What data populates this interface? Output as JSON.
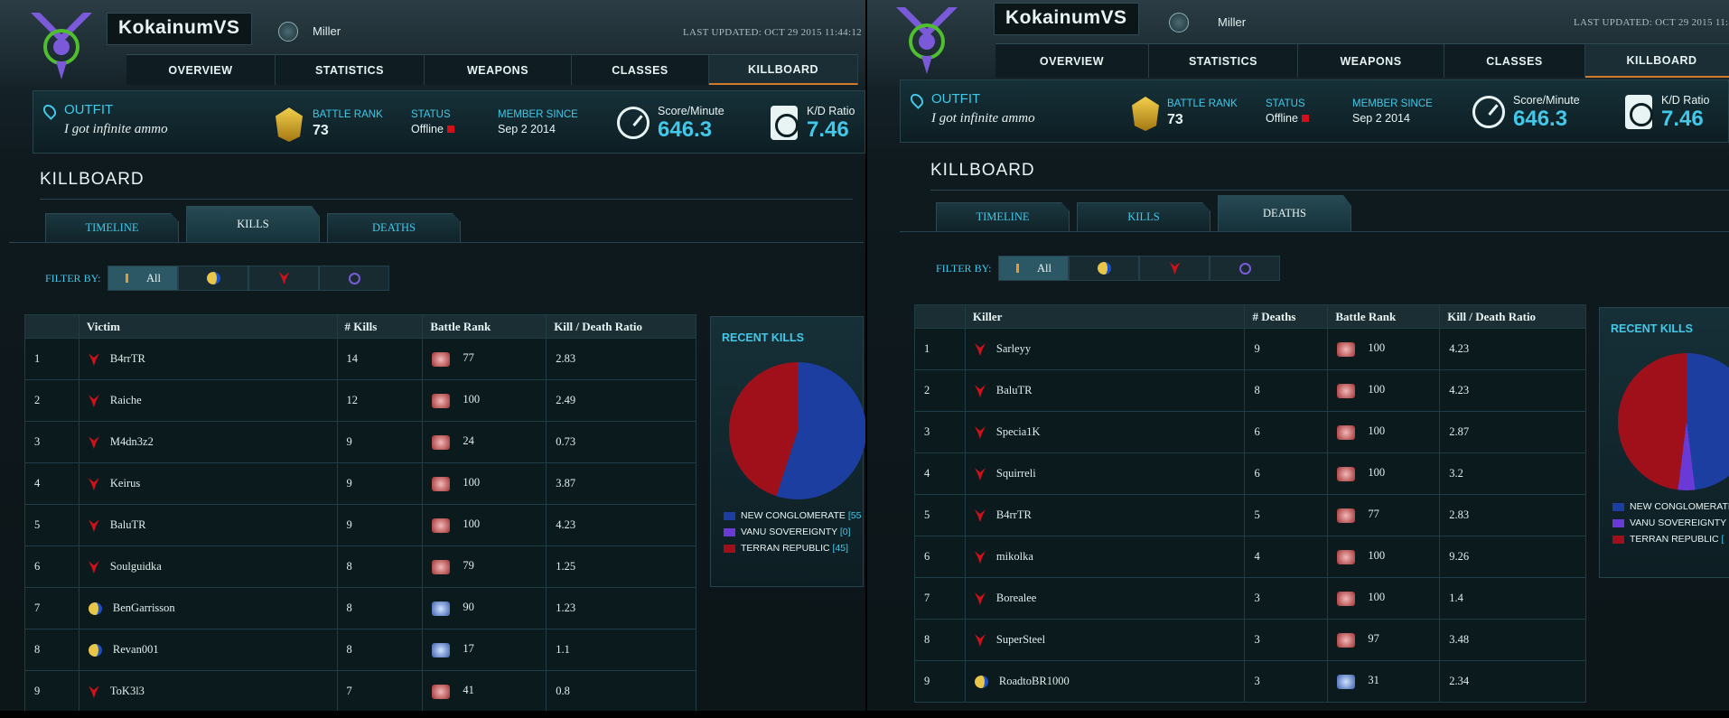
{
  "player": {
    "name": "KokainumVS",
    "server": "Miller",
    "last_updated": "LAST UPDATED: OCT 29 2015 11:44:12"
  },
  "nav": [
    "OVERVIEW",
    "STATISTICS",
    "WEAPONS",
    "CLASSES",
    "KILLBOARD"
  ],
  "stats": {
    "outfit_label": "OUTFIT",
    "outfit_name": "I got infinite ammo",
    "battle_rank_label": "BATTLE RANK",
    "battle_rank": "73",
    "status_label": "STATUS",
    "status": "Offline",
    "member_since_label": "MEMBER SINCE",
    "member_since": "Sep 2 2014",
    "spm_label": "Score/Minute",
    "spm": "646.3",
    "kd_label": "K/D Ratio",
    "kd": "7.46"
  },
  "killboard_title": "KILLBOARD",
  "subtabs": [
    "TIMELINE",
    "KILLS",
    "DEATHS"
  ],
  "filter": {
    "label": "FILTER BY:",
    "all": "All"
  },
  "colors": {
    "accent": "#42c8e8",
    "nc": "#1b3ea0",
    "vs": "#6a3ad6",
    "tr": "#a0101a",
    "active_nav": "#d07a2e"
  },
  "kills": {
    "headers": [
      "",
      "Victim",
      "# Kills",
      "Battle Rank",
      "Kill / Death Ratio"
    ],
    "rows": [
      {
        "n": "1",
        "name": "B4rrTR",
        "fac": "tr",
        "count": "14",
        "br": "77",
        "kd": "2.83"
      },
      {
        "n": "2",
        "name": "Raiche",
        "fac": "tr",
        "count": "12",
        "br": "100",
        "kd": "2.49"
      },
      {
        "n": "3",
        "name": "M4dn3z2",
        "fac": "tr",
        "count": "9",
        "br": "24",
        "kd": "0.73"
      },
      {
        "n": "4",
        "name": "Keirus",
        "fac": "tr",
        "count": "9",
        "br": "100",
        "kd": "3.87"
      },
      {
        "n": "5",
        "name": "BaluTR",
        "fac": "tr",
        "count": "9",
        "br": "100",
        "kd": "4.23"
      },
      {
        "n": "6",
        "name": "Soulguidka",
        "fac": "tr",
        "count": "8",
        "br": "79",
        "kd": "1.25"
      },
      {
        "n": "7",
        "name": "BenGarrisson",
        "fac": "nc",
        "count": "8",
        "br": "90",
        "kd": "1.23"
      },
      {
        "n": "8",
        "name": "Revan001",
        "fac": "nc",
        "count": "8",
        "br": "17",
        "kd": "1.1"
      },
      {
        "n": "9",
        "name": "ToK3l3",
        "fac": "tr",
        "count": "7",
        "br": "41",
        "kd": "0.8"
      }
    ],
    "recent_title": "RECENT KILLS",
    "legend": [
      {
        "label": "NEW CONGLOMERATE",
        "count": "[55"
      },
      {
        "label": "VANU SOVEREIGNTY",
        "count": "[0]"
      },
      {
        "label": "TERRAN REPUBLIC",
        "count": "[45]"
      }
    ],
    "pie_nc_fraction": 0.55
  },
  "deaths": {
    "headers": [
      "",
      "Killer",
      "# Deaths",
      "Battle Rank",
      "Kill / Death Ratio"
    ],
    "rows": [
      {
        "n": "1",
        "name": "Sarleyy",
        "fac": "tr",
        "count": "9",
        "br": "100",
        "kd": "4.23"
      },
      {
        "n": "2",
        "name": "BaluTR",
        "fac": "tr",
        "count": "8",
        "br": "100",
        "kd": "4.23"
      },
      {
        "n": "3",
        "name": "Specia1K",
        "fac": "tr",
        "count": "6",
        "br": "100",
        "kd": "2.87"
      },
      {
        "n": "4",
        "name": "Squirreli",
        "fac": "tr",
        "count": "6",
        "br": "100",
        "kd": "3.2"
      },
      {
        "n": "5",
        "name": "B4rrTR",
        "fac": "tr",
        "count": "5",
        "br": "77",
        "kd": "2.83"
      },
      {
        "n": "6",
        "name": "mikolka",
        "fac": "tr",
        "count": "4",
        "br": "100",
        "kd": "9.26"
      },
      {
        "n": "7",
        "name": "Borealee",
        "fac": "tr",
        "count": "3",
        "br": "100",
        "kd": "1.4"
      },
      {
        "n": "8",
        "name": "SuperSteel",
        "fac": "tr",
        "count": "3",
        "br": "97",
        "kd": "3.48"
      },
      {
        "n": "9",
        "name": "RoadtoBR1000",
        "fac": "nc",
        "count": "3",
        "br": "31",
        "kd": "2.34"
      }
    ],
    "recent_title": "RECENT KILLS",
    "legend": [
      {
        "label": "NEW CONGLOMERATE",
        "count": ""
      },
      {
        "label": "VANU SOVEREIGNTY",
        "count": ""
      },
      {
        "label": "TERRAN REPUBLIC",
        "count": "["
      }
    ],
    "pie_nc_fraction": 0.48,
    "pie_vs_fraction": 0.04
  }
}
